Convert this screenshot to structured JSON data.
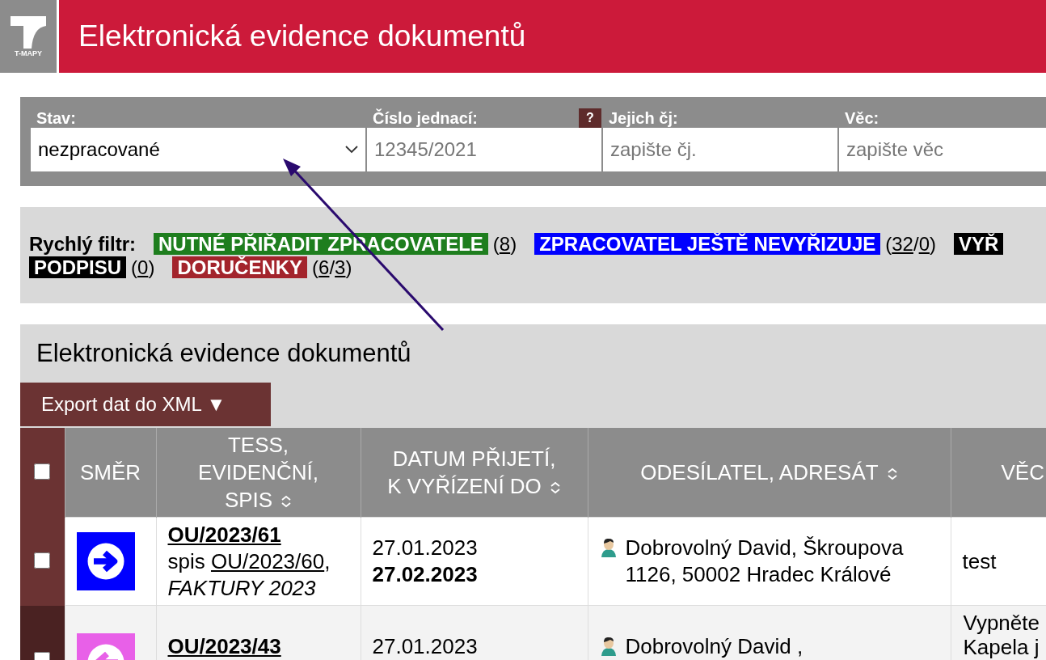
{
  "header": {
    "logo_caption": "T-MAPY",
    "title": "Elektronická evidence dokumentů"
  },
  "filters": [
    {
      "label": "Stav:",
      "kind": "select",
      "value": "nezpracované"
    },
    {
      "label": "Číslo jednací:",
      "kind": "input",
      "placeholder": "12345/2021",
      "help": "?"
    },
    {
      "label": "Jejich čj:",
      "kind": "input",
      "placeholder": "zapište čj."
    },
    {
      "label": "Věc:",
      "kind": "input",
      "placeholder": "zapište věc"
    }
  ],
  "quick_filter": {
    "label": "Rychlý filtr:",
    "items": [
      {
        "lines": [
          "NUTNÉ PŘIŘADIT ZPRACOVATELE"
        ],
        "color": "#1e7e1e",
        "count": "(8)"
      },
      {
        "lines": [
          "ZPRACOVATEL JEŠTĚ NEVYŘIZUJE"
        ],
        "color": "#0000ff",
        "count": "(32/0)"
      },
      {
        "lines": [
          "VYŘ",
          "PODPISU"
        ],
        "color": "#000000",
        "count": "(0)"
      },
      {
        "lines": [
          "DORUČENKY"
        ],
        "color": "#a3242c",
        "count": "(6/3)"
      }
    ]
  },
  "section": {
    "title": "Elektronická evidence dokumentů",
    "export_button": "Export dat do XML ▼"
  },
  "table": {
    "select_all_checked": false,
    "columns": [
      {
        "lines": [
          "SMĚR"
        ],
        "sortable": false
      },
      {
        "lines": [
          "TESS,",
          "EVIDENČNÍ,",
          "SPIS"
        ],
        "sortable": true
      },
      {
        "lines": [
          "DATUM PŘIJETÍ,",
          "K VYŘÍZENÍ DO"
        ],
        "sortable": true
      },
      {
        "lines": [
          "ODESÍLATEL, ADRESÁT"
        ],
        "sortable": true
      },
      {
        "lines": [
          "VĚC"
        ]
      }
    ],
    "rows": [
      {
        "checked": false,
        "kind": "outgoing",
        "color": "#0000ff",
        "number": "OU/2023/61",
        "spis_label": "spis",
        "spis_link": "OU/2023/60",
        "spis_suffix": ",",
        "folder": "FAKTURY 2023",
        "received": "27.01.2023",
        "due": "27.02.2023",
        "sender": "Dobrovolný David, Škroupova 1126, 50002 Hradec Králové",
        "subject_lines": [
          "test"
        ]
      },
      {
        "checked": false,
        "kind": "incoming",
        "color": "#e860e8",
        "number": "OU/2023/43",
        "received": "27.01.2023",
        "sender": "Dobrovolný David ,",
        "subject_lines": [
          "Vypněte",
          "Kapela j"
        ]
      }
    ]
  }
}
